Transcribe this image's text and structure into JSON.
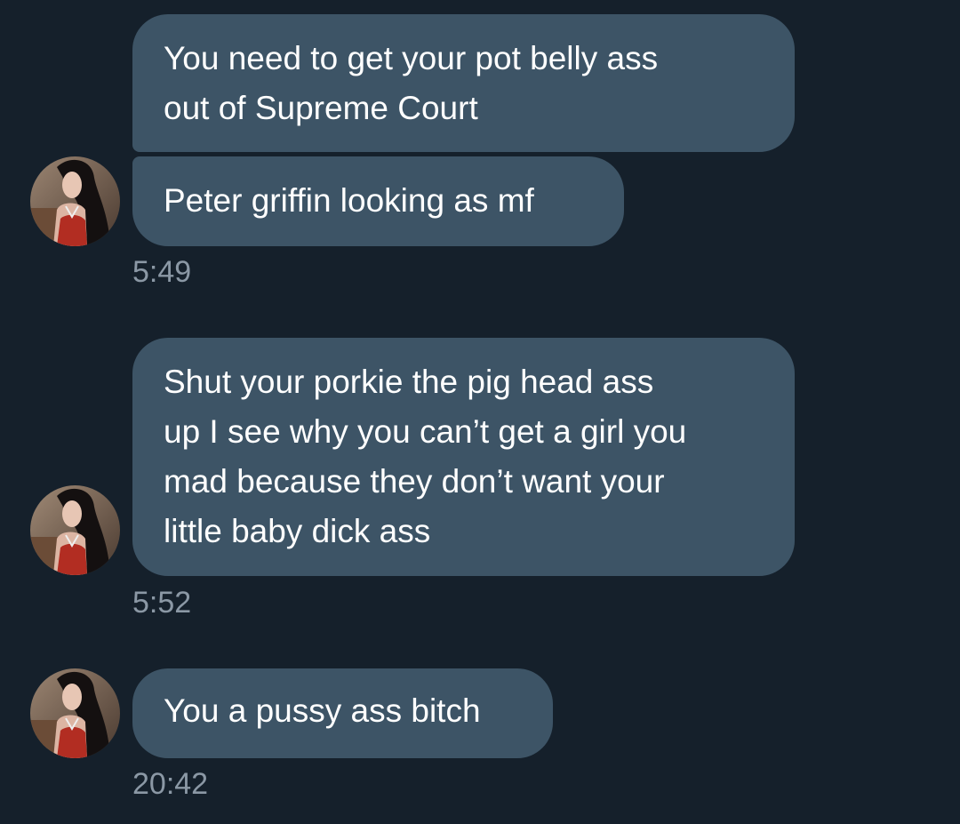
{
  "conversation": {
    "messages": [
      {
        "lines": "You need to get your pot belly ass\nout of Supreme Court"
      },
      {
        "lines": "Peter griffin looking as mf"
      },
      {
        "lines": "Shut your porkie the pig head ass\nup I see why you can’t get a girl you\nmad because they don’t want your\nlittle baby dick ass"
      },
      {
        "lines": "You a pussy ass bitch"
      }
    ],
    "timestamps": [
      "5:49",
      "5:52",
      "20:42"
    ]
  },
  "colors": {
    "background": "#15202b",
    "bubble": "#3d5466",
    "text": "#ffffff",
    "timestamp": "#8b98a5"
  },
  "icons": {
    "avatar": "profile-photo-avatar"
  }
}
